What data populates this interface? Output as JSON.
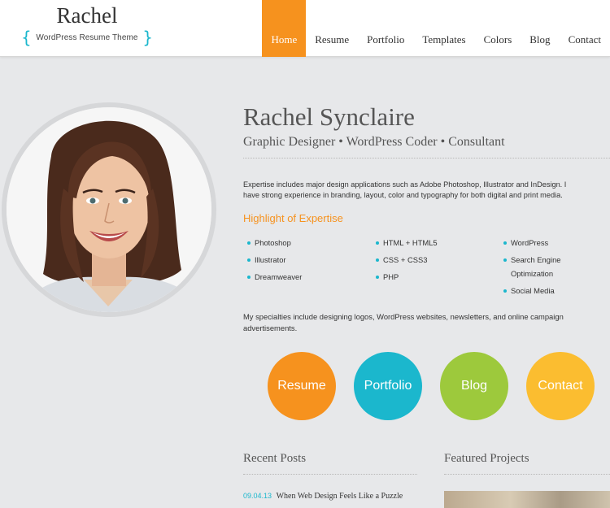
{
  "site": {
    "title": "Rachel",
    "tagline": "WordPress Resume Theme",
    "brace_left": "{",
    "brace_right": "}"
  },
  "nav": {
    "items": [
      {
        "label": "Home",
        "active": true
      },
      {
        "label": "Resume"
      },
      {
        "label": "Portfolio"
      },
      {
        "label": "Templates"
      },
      {
        "label": "Colors"
      },
      {
        "label": "Blog"
      },
      {
        "label": "Contact"
      }
    ]
  },
  "profile": {
    "name": "Rachel Synclaire",
    "subtitle": "Graphic Designer • WordPress Coder • Consultant",
    "intro_line1": "Expertise includes major design applications such as Adobe Photoshop, Illustrator and InDesign. I",
    "intro_line2": "have strong experience in branding, layout, color and typography for both digital and print media."
  },
  "highlights": {
    "title": "Highlight of Expertise",
    "col1": [
      "Photoshop",
      "Illustrator",
      "Dreamweaver"
    ],
    "col2": [
      "HTML + HTML5",
      "CSS + CSS3",
      "PHP"
    ],
    "col3": [
      "WordPress",
      "Search Engine Optimization",
      "Social Media"
    ]
  },
  "specialties": "My specialties include designing logos, WordPress websites, newsletters, and online campaign advertisements.",
  "circles": [
    {
      "label": "Resume",
      "color": "#f6921e"
    },
    {
      "label": "Portfolio",
      "color": "#1bb7cd"
    },
    {
      "label": "Blog",
      "color": "#9dc93c"
    },
    {
      "label": "Contact",
      "color": "#fbbd30"
    }
  ],
  "recent_posts": {
    "title": "Recent Posts",
    "items": [
      {
        "date": "09.04.13",
        "title": "When Web Design Feels Like a Puzzle"
      }
    ]
  },
  "featured_projects": {
    "title": "Featured Projects"
  },
  "colors": {
    "accent_orange": "#f6921e",
    "accent_cyan": "#1bb7cd",
    "background": "#e7e8ea"
  }
}
